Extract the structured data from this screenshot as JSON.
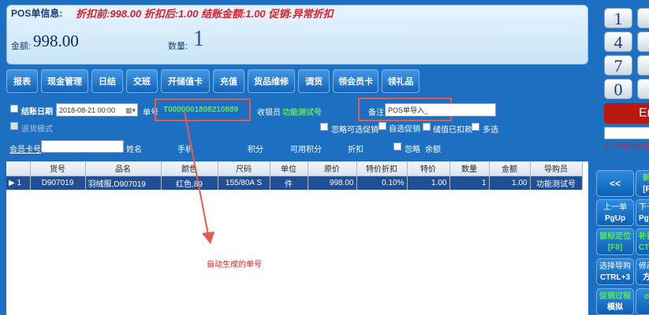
{
  "info": {
    "title": "POS单信息:",
    "status": "折扣前:998.00 折扣后:1.00 结账金额:1.00 促销:异常折扣",
    "amount_label": "金额:",
    "amount_value": "998.00",
    "qty_label": "数量:",
    "qty_value": "1"
  },
  "keypad": {
    "keys": [
      "1",
      "4",
      "7",
      "0"
    ],
    "enter_label": "Er",
    "hint": "在上框录入条码/会员卡号、数量等",
    "side_buttons": [
      {
        "line1": "<<",
        "line2": ""
      },
      {
        "line1": "上一单",
        "line2": "PgUp"
      },
      {
        "line1": "鼠标定位",
        "line2": "[F8]"
      },
      {
        "line1": "选择导购",
        "line2": "CTRL+3"
      },
      {
        "line1": "促销过程",
        "line2": "模拟"
      }
    ],
    "side_buttons_cut": [
      {
        "line1": "新",
        "line2": "[F"
      },
      {
        "line1": "下一",
        "line2": "PgD"
      },
      {
        "line1": "补打",
        "line2": "CTR"
      },
      {
        "line1": "修改",
        "line2": "方"
      },
      {
        "line1": "o",
        "line2": ""
      }
    ]
  },
  "nav": [
    "报表",
    "现金管理",
    "日结",
    "交班",
    "开储值卡",
    "充值",
    "货品维修",
    "调货",
    "领会员卡",
    "领礼品"
  ],
  "form": {
    "settle_date_label": "结账日期",
    "settle_date_value": "2018-08-21 00:00",
    "order_label": "单号",
    "order_value": "T0000001808210889",
    "cashier_label": "收银员",
    "cashier_value": "功能测试号",
    "remark_label": "备注",
    "remark_value": "POS单导入_",
    "return_label": "退货模式",
    "ignore_optional_promo": "忽略可选促销",
    "self_select_promo": "自选促销",
    "stored_value_discount": "储值已扣款",
    "multi_select": "多选",
    "member_card_label": "会员卡号",
    "name_label": "姓名",
    "phone_label": "手机",
    "points_label": "积分",
    "available_points_label": "可用积分",
    "discount_label": "折扣",
    "ignore_label": "忽略",
    "balance_label": "余额"
  },
  "table": {
    "headers": [
      "",
      "货号",
      "品名",
      "颜色",
      "尺码",
      "单位",
      "原价",
      "特价折扣",
      "特价",
      "数量",
      "金额",
      "导购员"
    ],
    "rows": [
      [
        "▶ 1",
        "D907019",
        "羽绒服,D907019",
        "红色,89",
        "155/80A S",
        "件",
        "998.00",
        "0.10%",
        "1.00",
        "1",
        "1.00",
        "功能测试号"
      ]
    ]
  },
  "annotation": {
    "text": "自动生成的单号"
  }
}
